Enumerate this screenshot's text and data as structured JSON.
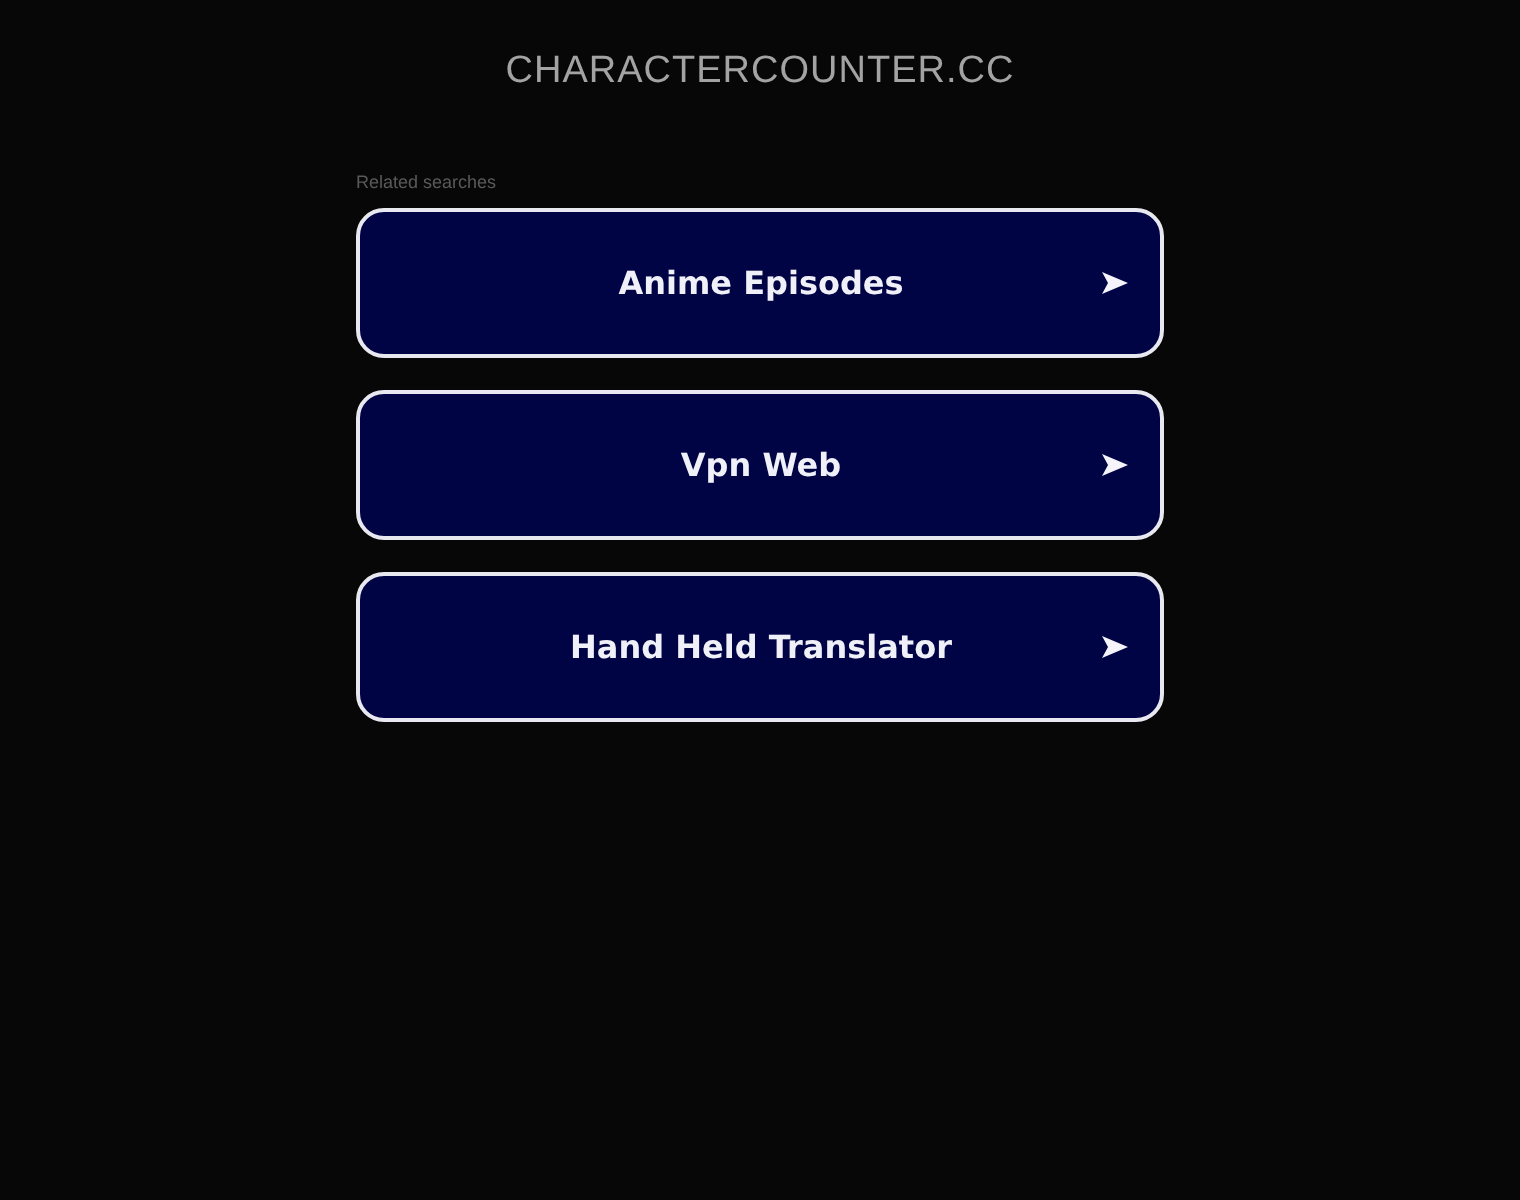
{
  "site": {
    "title": "CHARACTERCOUNTER.CC"
  },
  "related": {
    "heading": "Related searches",
    "links": [
      {
        "label": "Anime Episodes"
      },
      {
        "label": "Vpn Web"
      },
      {
        "label": "Hand Held Translator"
      }
    ]
  }
}
